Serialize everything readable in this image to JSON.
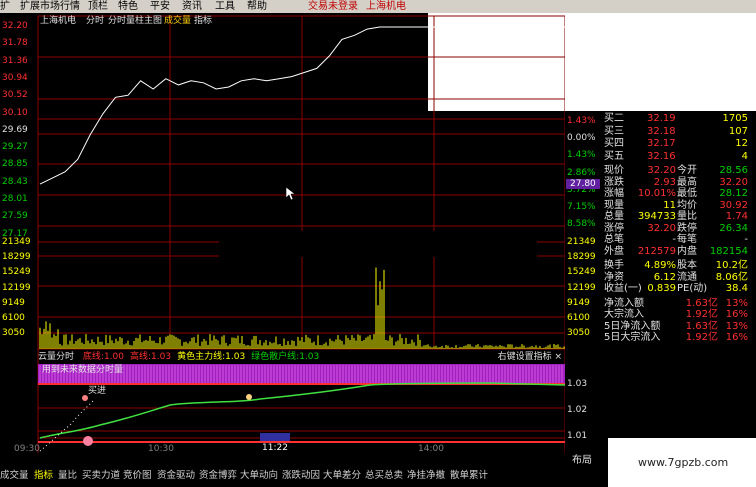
{
  "menu": {
    "items": [
      "扩",
      "扩展市场行情",
      "顶栏",
      "特色",
      "平安",
      "资讯",
      "工具",
      "帮助"
    ],
    "status_login": "交易未登录",
    "status_stock": "上海机电"
  },
  "chart": {
    "title": "上海机电",
    "views": [
      "分时",
      "分时量柱主图",
      "成交量",
      "指标"
    ],
    "price_labels_left": [
      "32.20",
      "31.78",
      "31.36",
      "30.94",
      "30.52",
      "30.10",
      "29.69",
      "29.27",
      "28.85",
      "28.43",
      "28.01",
      "27.59",
      "27.17"
    ],
    "pct_labels_right": [
      "1.43%",
      "0.00%",
      "1.43%",
      "2.86%",
      "5.72%",
      "7.15%",
      "8.58%"
    ],
    "current_price_marker": "27.80",
    "volume_labels_left": [
      "21349",
      "18299",
      "15249",
      "12199",
      "9149",
      "6100",
      "3050"
    ],
    "volume_labels_right": [
      "21349",
      "18299",
      "15249",
      "12199",
      "9149",
      "6100",
      "3050"
    ],
    "indicator_header": {
      "name": "云量分时",
      "items": [
        {
          "label": "底线:",
          "value": "1.00",
          "color": "#ff3030"
        },
        {
          "label": "高线:",
          "value": "1.03",
          "color": "#ff3030"
        },
        {
          "label": "黄色主力线:",
          "value": "1.03",
          "color": "#ffff00"
        },
        {
          "label": "绿色散户线:",
          "value": "1.03",
          "color": "#00d000"
        }
      ],
      "right_hint": "右键设置指标"
    },
    "indicator_labels_right": [
      "1.03",
      "1.02",
      "1.01"
    ],
    "band_text": "用到未来数据分时量",
    "annotation_text": "买进",
    "time_labels": [
      "09:30",
      "10:30",
      "11:22",
      "14:00"
    ],
    "corner_label": "布局"
  },
  "chart_data": {
    "type": "line",
    "title": "",
    "xlabel": "",
    "ylabel": "",
    "ylim": [
      27.17,
      32.2
    ],
    "series": [
      {
        "values": [
          28.4,
          28.55,
          28.7,
          29.0,
          29.6,
          30.1,
          30.5,
          30.55,
          30.9,
          30.7,
          30.95,
          30.8,
          30.9,
          30.85,
          30.7,
          30.75,
          30.9,
          30.95,
          30.9,
          30.95,
          31.0,
          31.1,
          31.2,
          31.5,
          31.9,
          32.0,
          32.15,
          32.2,
          32.2,
          32.2,
          32.2,
          32.2
        ]
      }
    ]
  },
  "quote_panel": {
    "rows": [
      {
        "label": "买二",
        "value": "32.19",
        "extra": "1705",
        "vcolor": "#ff3030",
        "ecolor": "#ffff00"
      },
      {
        "label": "买三",
        "value": "32.18",
        "extra": "107",
        "vcolor": "#ff3030",
        "ecolor": "#ffff00"
      },
      {
        "label": "买四",
        "value": "32.17",
        "extra": "12",
        "vcolor": "#ff3030",
        "ecolor": "#ffff00"
      },
      {
        "label": "买五",
        "value": "32.16",
        "extra": "4",
        "vcolor": "#ff3030",
        "ecolor": "#ffff00"
      }
    ],
    "grid": [
      {
        "l1": "现价",
        "v1": "32.20",
        "c1": "#ff3030",
        "l2": "今开",
        "v2": "28.56",
        "c2": "#00d000"
      },
      {
        "l1": "涨跌",
        "v1": "2.93",
        "c1": "#ff3030",
        "l2": "最高",
        "v2": "32.20",
        "c2": "#ff3030"
      },
      {
        "l1": "涨幅",
        "v1": "10.01%",
        "c1": "#ff3030",
        "l2": "最低",
        "v2": "28.12",
        "c2": "#00d000"
      },
      {
        "l1": "现量",
        "v1": "11",
        "c1": "#ffff00",
        "l2": "均价",
        "v2": "30.92",
        "c2": "#ff3030"
      },
      {
        "l1": "总量",
        "v1": "394733",
        "c1": "#ffff00",
        "l2": "量比",
        "v2": "1.74",
        "c2": "#ff3030"
      },
      {
        "l1": "涨停",
        "v1": "32.20",
        "c1": "#ff3030",
        "l2": "跌停",
        "v2": "26.34",
        "c2": "#00d000"
      },
      {
        "l1": "总笔",
        "v1": "-",
        "c1": "#e0e0e0",
        "l2": "每笔",
        "v2": "-",
        "c2": "#e0e0e0"
      },
      {
        "l1": "外盘",
        "v1": "212579",
        "c1": "#ff3030",
        "l2": "内盘",
        "v2": "182154",
        "c2": "#00d000"
      }
    ],
    "grid2": [
      {
        "l1": "换手",
        "v1": "4.89%",
        "c1": "#ffff00",
        "l2": "股本",
        "v2": "10.2亿",
        "c2": "#ffff00"
      },
      {
        "l1": "净资",
        "v1": "6.12",
        "c1": "#ffff00",
        "l2": "流通",
        "v2": "8.06亿",
        "c2": "#ffff00"
      },
      {
        "l1": "收益(一)",
        "v1": "0.839",
        "c1": "#ffff00",
        "l2": "PE(动)",
        "v2": "38.4",
        "c2": "#ffff00"
      }
    ],
    "flows": [
      {
        "label": "净流入额",
        "value": "1.63亿",
        "pct": "13%"
      },
      {
        "label": "大宗流入",
        "value": "1.92亿",
        "pct": "16%"
      },
      {
        "label": "5日净流入额",
        "value": "1.63亿",
        "pct": "13%"
      },
      {
        "label": "5日大宗流入",
        "value": "1.92亿",
        "pct": "16%"
      }
    ]
  },
  "tabs": [
    "成交量",
    "指标",
    "量比",
    "买卖力道",
    "竞价图",
    "资金驱动",
    "资金博弈",
    "大单动向",
    "涨跌动因",
    "大单差分",
    "总买总卖",
    "净挂净撤",
    "散单累计"
  ],
  "watermark": "www.7gpzb.com"
}
